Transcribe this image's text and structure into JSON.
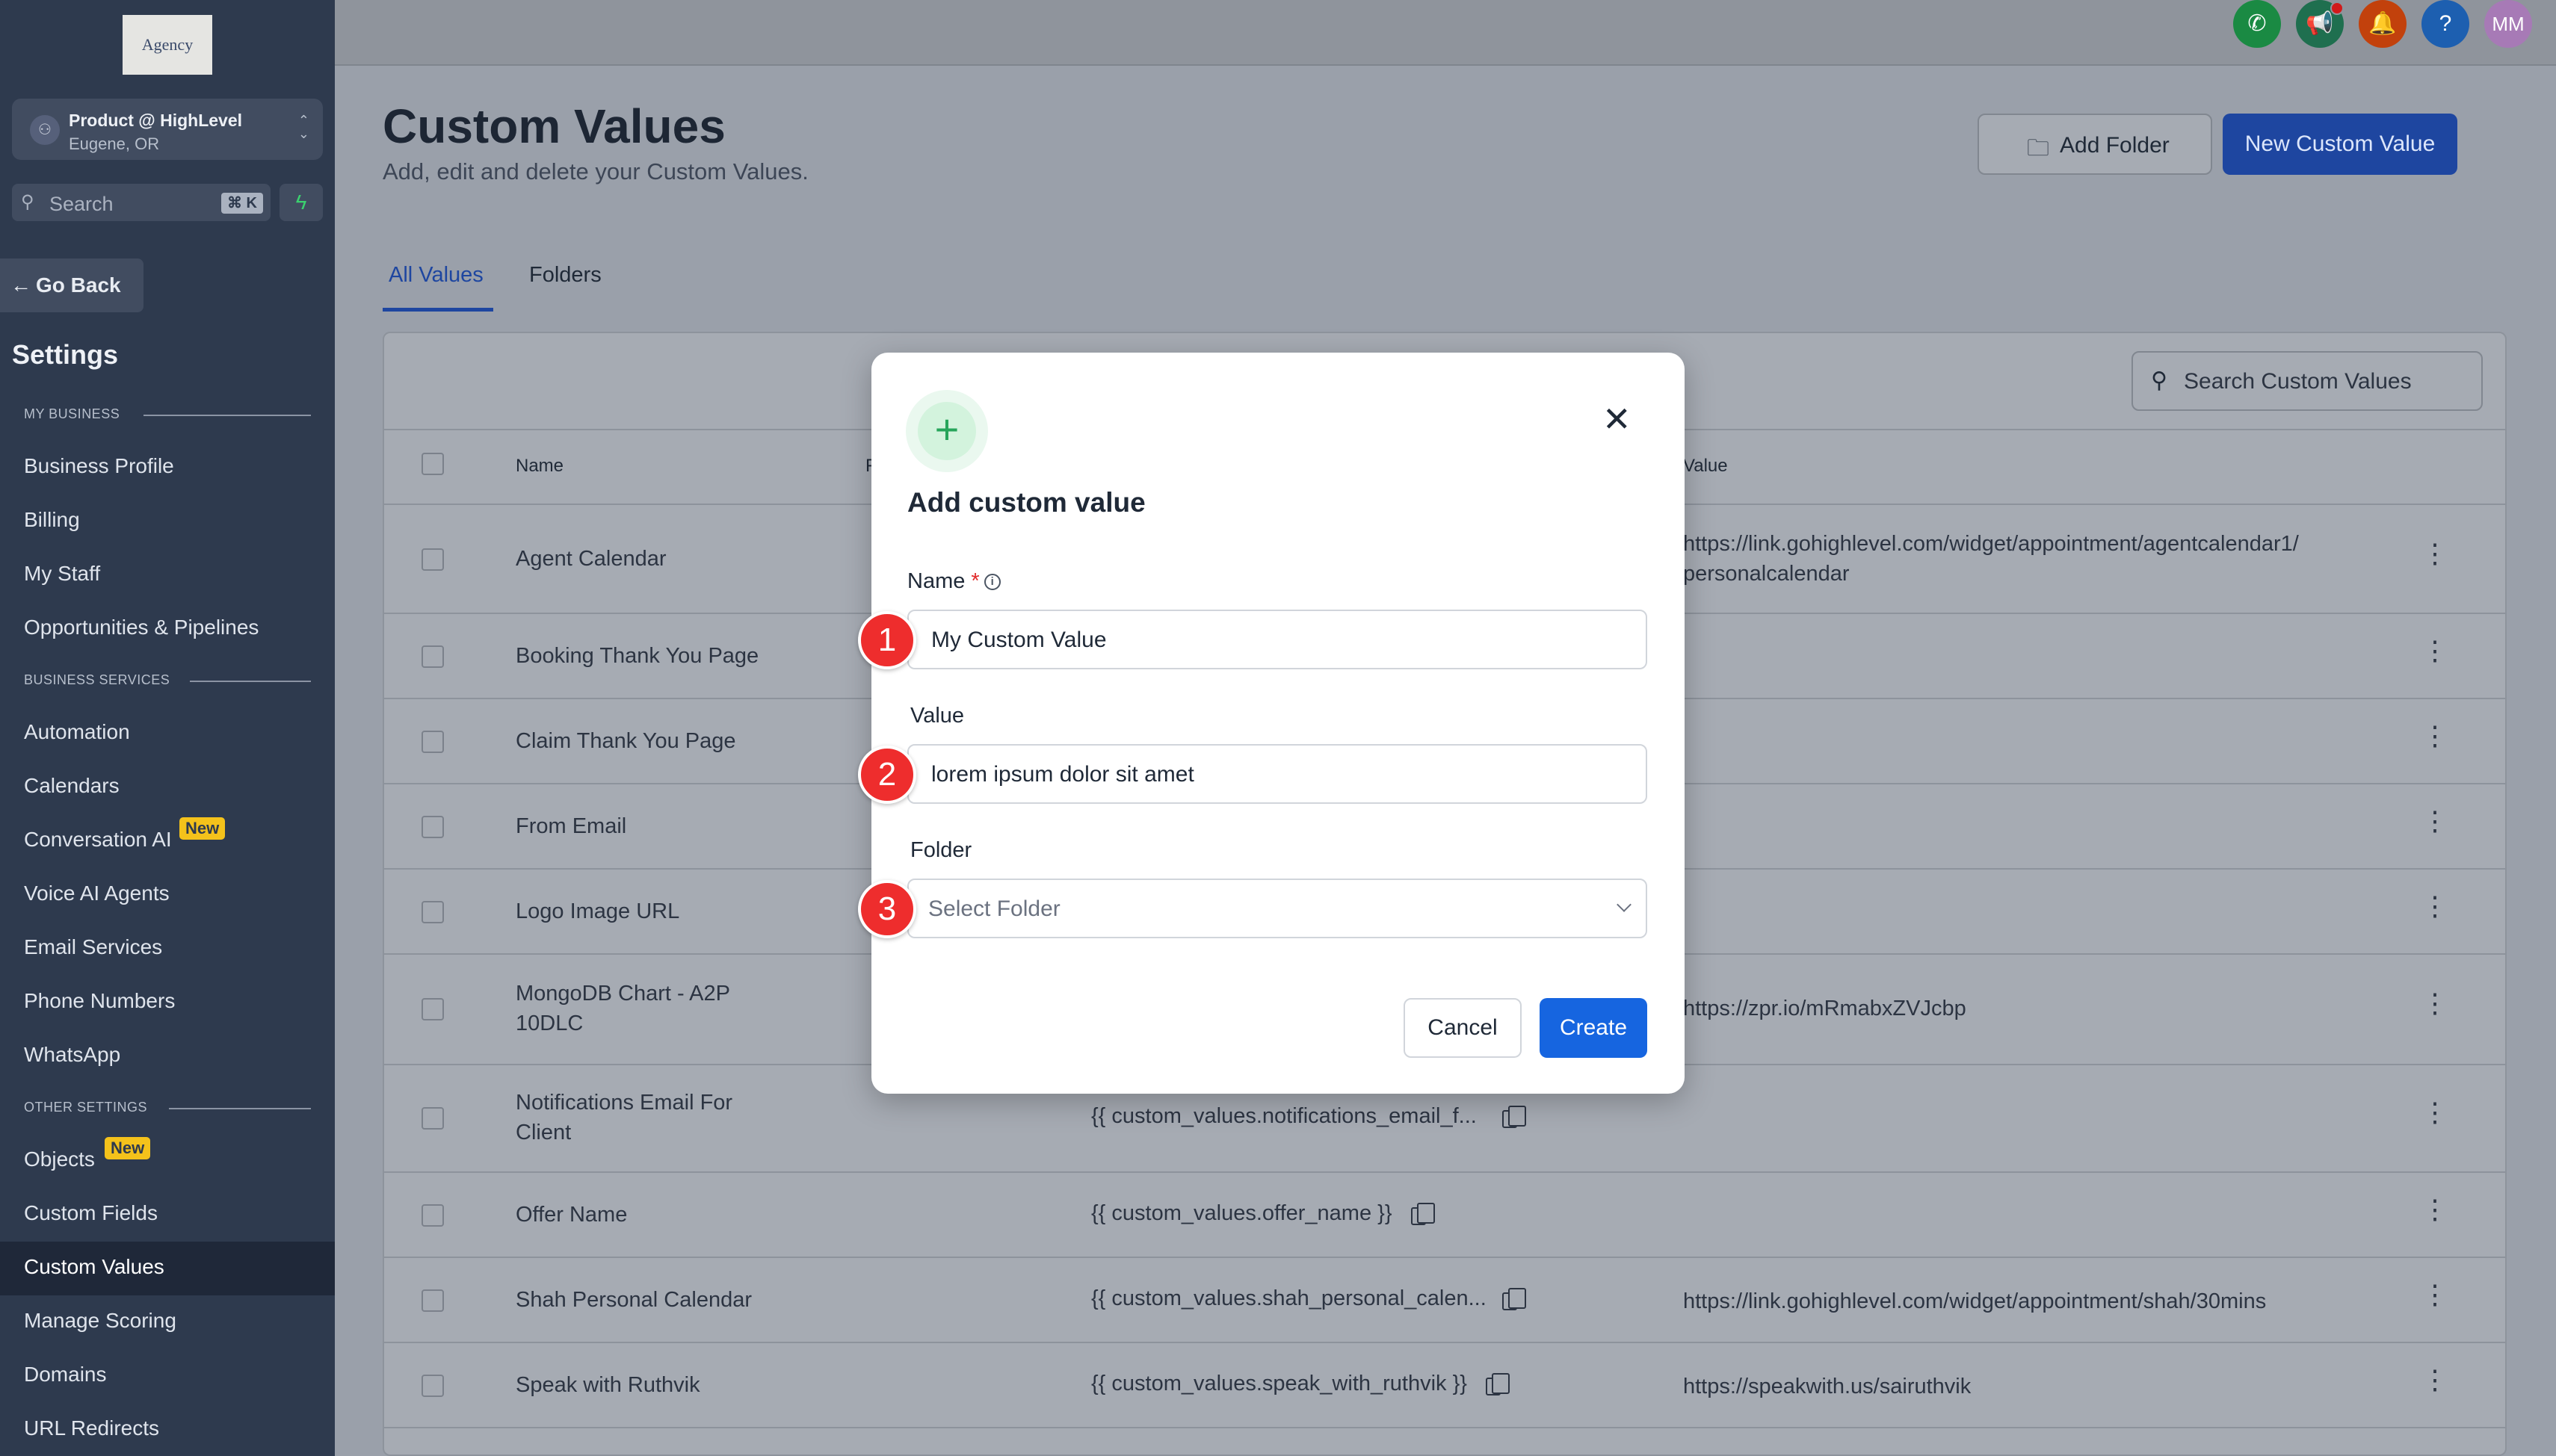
{
  "sidebar": {
    "logo_text": "Agency",
    "account": {
      "name": "Product @ HighLevel",
      "location": "Eugene, OR"
    },
    "search": {
      "placeholder": "Search",
      "shortcut": "⌘ K"
    },
    "go_back": "Go Back",
    "settings_title": "Settings",
    "sections": {
      "my_business": "MY BUSINESS",
      "business_services": "BUSINESS SERVICES",
      "other_settings": "OTHER SETTINGS"
    },
    "items": {
      "business_profile": "Business Profile",
      "billing": "Billing",
      "my_staff": "My Staff",
      "opportunities": "Opportunities & Pipelines",
      "automation": "Automation",
      "calendars": "Calendars",
      "conversation_ai": "Conversation AI",
      "voice_ai": "Voice AI Agents",
      "email_services": "Email Services",
      "phone_numbers": "Phone Numbers",
      "whatsapp": "WhatsApp",
      "objects": "Objects",
      "custom_fields": "Custom Fields",
      "custom_values": "Custom Values",
      "manage_scoring": "Manage Scoring",
      "domains": "Domains",
      "url_redirects": "URL Redirects"
    },
    "badge_new": "New",
    "active_item": "Custom Values"
  },
  "topbar": {
    "avatar_initials": "MM",
    "colors": {
      "phone": "#1a8a43",
      "megaphone": "#1f6f4f",
      "bell": "#c2410c",
      "help": "#1d5fb0",
      "avatar": "#a77ab6"
    }
  },
  "page": {
    "title": "Custom Values",
    "subtitle": "Add, edit and delete your Custom Values.",
    "add_folder": "Add Folder",
    "new_custom_value": "New Custom Value",
    "tabs": [
      "All Values",
      "Folders"
    ],
    "search_placeholder": "Search Custom Values",
    "columns": {
      "name": "Name",
      "key": "F",
      "value": "Value"
    }
  },
  "rows": [
    {
      "name": "Agent Calendar",
      "key": "",
      "value": "https://link.gohighlevel.com/widget/appointment/agentcalendar1/ personalcalendar"
    },
    {
      "name": "Booking Thank You Page",
      "key": "",
      "value": ""
    },
    {
      "name": "Claim Thank You Page",
      "key": "",
      "value": ""
    },
    {
      "name": "From Email",
      "key": "",
      "value": ""
    },
    {
      "name": "Logo Image URL",
      "key": "",
      "value": ""
    },
    {
      "name": "MongoDB Chart - A2P 10DLC",
      "key": "",
      "value": "https://zpr.io/mRmabxZVJcbp"
    },
    {
      "name": "Notifications Email For Client",
      "key": "{{ custom_values.notifications_email_f...",
      "value": ""
    },
    {
      "name": "Offer Name",
      "key": "{{ custom_values.offer_name }}",
      "value": ""
    },
    {
      "name": "Shah Personal Calendar",
      "key": "{{ custom_values.shah_personal_calen...",
      "value": "https://link.gohighlevel.com/widget/appointment/shah/30mins"
    },
    {
      "name": "Speak with Ruthvik",
      "key": "{{ custom_values.speak_with_ruthvik }}",
      "value": "https://speakwith.us/sairuthvik"
    }
  ],
  "modal": {
    "title": "Add custom value",
    "name_label": "Name",
    "required_mark": "*",
    "name_value": "My Custom Value",
    "value_label": "Value",
    "value_value": "lorem ipsum dolor sit amet",
    "folder_label": "Folder",
    "folder_placeholder": "Select Folder",
    "cancel": "Cancel",
    "create": "Create",
    "steps": [
      "1",
      "2",
      "3"
    ]
  }
}
